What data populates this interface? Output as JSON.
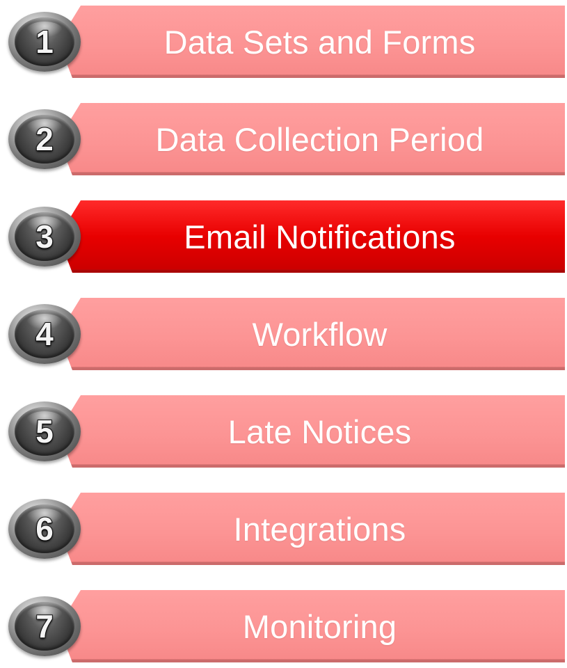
{
  "steps": [
    {
      "number": "1",
      "label": "Data Sets and Forms",
      "active": false
    },
    {
      "number": "2",
      "label": "Data Collection Period",
      "active": false
    },
    {
      "number": "3",
      "label": "Email Notifications",
      "active": true
    },
    {
      "number": "4",
      "label": "Workflow",
      "active": false
    },
    {
      "number": "5",
      "label": "Late Notices",
      "active": false
    },
    {
      "number": "6",
      "label": "Integrations",
      "active": false
    },
    {
      "number": "7",
      "label": "Monitoring",
      "active": false
    }
  ],
  "colors": {
    "inactive_bar": "#fc9494",
    "active_bar": "#e80000",
    "label_text": "#ffffff",
    "badge": "#3a3a3a"
  },
  "icons": {
    "badge_icon": "numbered-circle-icon"
  }
}
